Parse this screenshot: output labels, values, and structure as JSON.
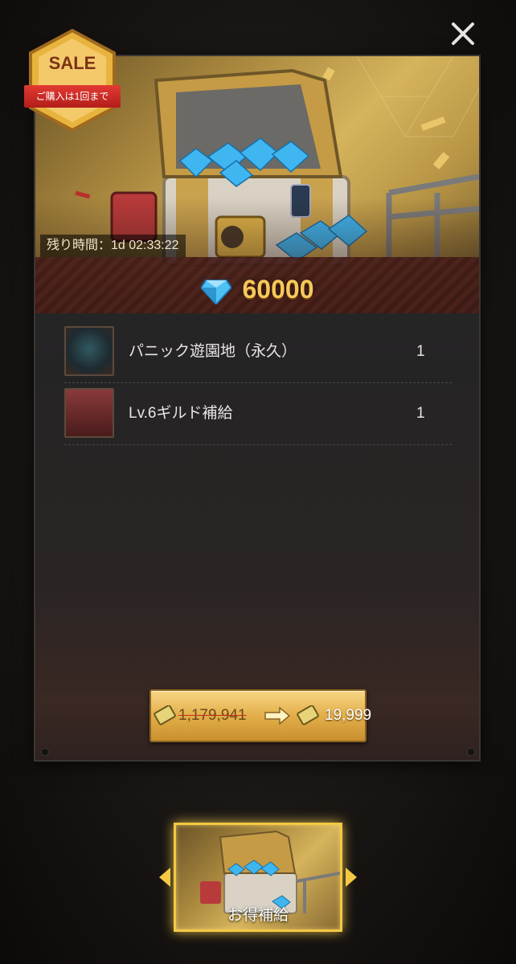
{
  "badge": {
    "sale": "SALE",
    "limit": "ご購入は1回まで"
  },
  "banner": {
    "timer": "残り時間：1d 02:33:22",
    "diamonds": "60000"
  },
  "items": [
    {
      "name": "パニック遊園地（永久）",
      "qty": "1",
      "icon": "panic-amusement-park-icon"
    },
    {
      "name": "Lv.6ギルド補給",
      "qty": "1",
      "icon": "guild-supply-chest-icon"
    }
  ],
  "price": {
    "original": "1,179,941",
    "current": "19,999"
  },
  "tab": {
    "label": "お得補給"
  },
  "colors": {
    "gold": "#f6c95a",
    "sale_red": "#e23a32",
    "glow": "#f4c843"
  }
}
